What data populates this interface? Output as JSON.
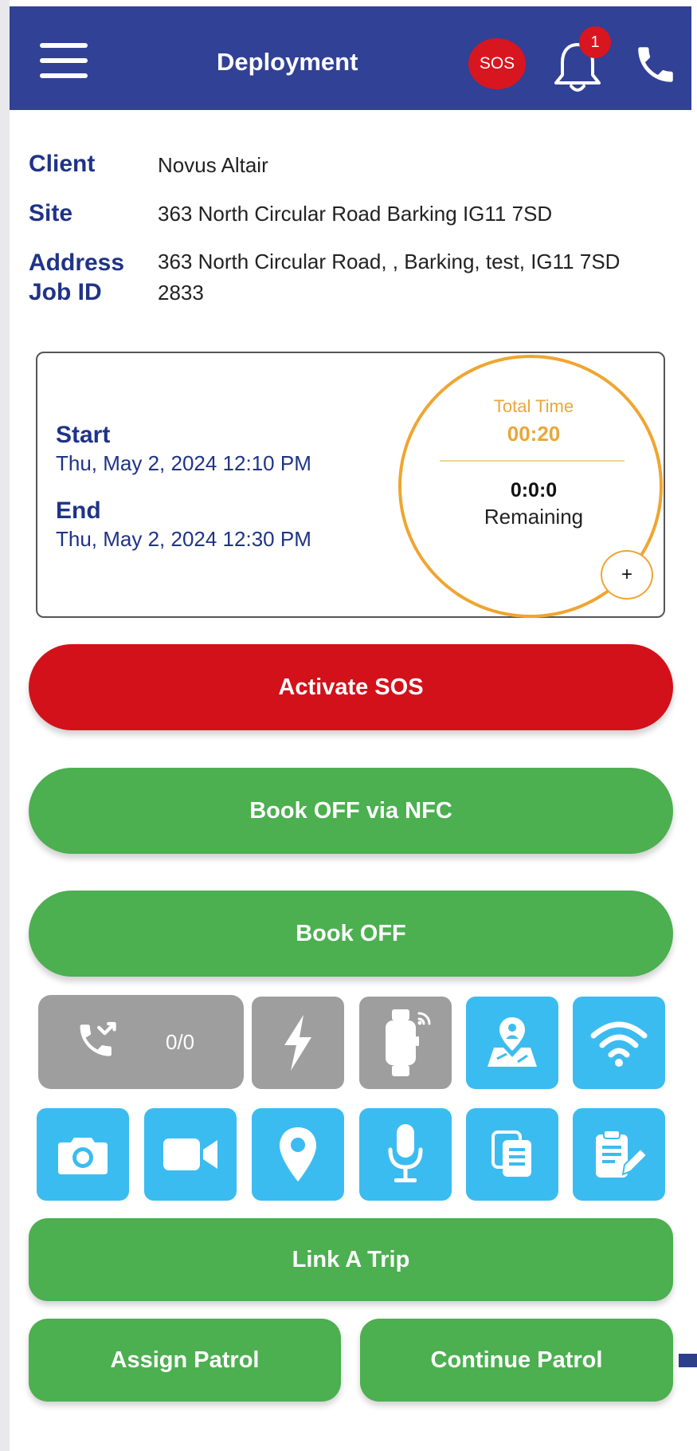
{
  "header": {
    "title": "Deployment",
    "sos_badge": "SOS",
    "notification_count": "1"
  },
  "job": {
    "client_label": "Client",
    "client": "Novus Altair",
    "site_label": "Site",
    "site": "363 North Circular Road Barking IG11 7SD",
    "address_label": "Address",
    "address": "363 North Circular Road, , Barking, test, IG11 7SD",
    "job_id_label": "Job ID",
    "job_id": "2833"
  },
  "time_card": {
    "start_label": "Start",
    "start": "Thu, May 2, 2024 12:10 PM",
    "end_label": "End",
    "end": "Thu, May 2, 2024 12:30 PM",
    "total_time_label": "Total Time",
    "total_time": "00:20",
    "remaining_value": "0:0:0",
    "remaining_label": "Remaining",
    "add_time": "+"
  },
  "actions": {
    "activate_sos": "Activate SOS",
    "book_off_nfc": "Book OFF via NFC",
    "book_off": "Book OFF",
    "link_trip": "Link A Trip",
    "assign_patrol": "Assign Patrol",
    "continue_patrol": "Continue Patrol"
  },
  "tools": {
    "call_count": "0/0",
    "icons_row1": [
      "missed-call-icon",
      "lightning-icon",
      "smartwatch-icon",
      "map-pin-person-icon",
      "wifi-icon"
    ],
    "icons_row2": [
      "camera-icon",
      "video-camera-icon",
      "location-pin-icon",
      "microphone-icon",
      "documents-icon",
      "clipboard-edit-icon"
    ]
  },
  "colors": {
    "header": "#314196",
    "label_blue": "#1f3387",
    "sos_red": "#d3111a",
    "green": "#4caf50",
    "tile_blue": "#3bbcf0",
    "tile_grey": "#9e9e9e",
    "timer_orange": "#f0a530"
  }
}
